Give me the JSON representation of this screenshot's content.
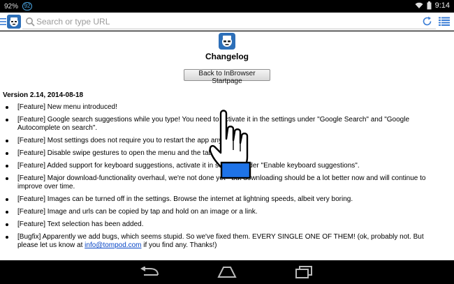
{
  "status": {
    "battery": "92%",
    "notification_badge": "92",
    "time": "9:14"
  },
  "toolbar": {
    "search_placeholder": "Search or type URL"
  },
  "page": {
    "title": "Changelog",
    "back_button": "Back to InBrowser Startpage",
    "version": "Version 2.14, 2014-08-18",
    "items": [
      {
        "text": "[Feature] New menu introduced!"
      },
      {
        "text": "[Feature] Google search suggestions while you type! You need to activate it in the settings under \"Google Search\" and \"Google Autocomplete on search\"."
      },
      {
        "text": "[Feature] Most settings does not require you to restart the app anymore."
      },
      {
        "text": "[Feature] Disable swipe gestures to open the menu and the tab-list."
      },
      {
        "text": "[Feature] Added support for keyboard suggestions, activate it in settings under \"Enable keyboard suggestions\"."
      },
      {
        "text": "[Feature] Major download-functionality overhaul, we're not done yet - but downloading should be a lot better now and will continue to improve over time."
      },
      {
        "text": "[Feature] Images can be turned off in the settings. Browse the internet at lightning speeds, albeit very boring."
      },
      {
        "text": "[Feature] Image and urls can be copied by tap and hold on an image or a link."
      },
      {
        "text": "[Feature] Text selection has been added."
      }
    ],
    "last_item": {
      "text_before": "[Bugfix] Apparently we add bugs, which seems stupid. So we've fixed them. EVERY SINGLE ONE OF THEM! (ok, probably not. But please let us know at ",
      "link": "info@tompod.com",
      "text_after": " if you find any. Thanks!)"
    }
  },
  "icons": {
    "menu": "menu-icon",
    "app": "inbrowser-logo-icon",
    "search": "search-icon",
    "refresh": "refresh-icon",
    "tabs": "tab-list-icon",
    "cursor": "hand-pointer-icon",
    "nav_back": "back-icon",
    "nav_home": "home-icon",
    "nav_recent": "recent-apps-icon"
  },
  "colors": {
    "link": "#0645c6",
    "accent": "#1e73e8",
    "toolbar_icon": "#3b7ed6"
  }
}
